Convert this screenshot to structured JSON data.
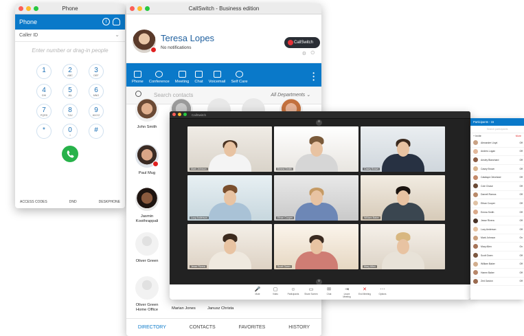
{
  "phone": {
    "title": "Phone",
    "header_label": "Phone",
    "caller_id_label": "Caller ID",
    "number_placeholder": "Enter number or drag-in people",
    "keys": [
      {
        "digit": "1",
        "letters": ""
      },
      {
        "digit": "2",
        "letters": "ABC"
      },
      {
        "digit": "3",
        "letters": "DEF"
      },
      {
        "digit": "4",
        "letters": "GHI"
      },
      {
        "digit": "5",
        "letters": "JKL"
      },
      {
        "digit": "6",
        "letters": "MNO"
      },
      {
        "digit": "7",
        "letters": "PQRS"
      },
      {
        "digit": "8",
        "letters": "TUV"
      },
      {
        "digit": "9",
        "letters": "WXYZ"
      },
      {
        "digit": "*",
        "letters": ""
      },
      {
        "digit": "0",
        "letters": "+"
      },
      {
        "digit": "#",
        "letters": ""
      }
    ],
    "footer": [
      "ACCESS CODES",
      "DND",
      "DESKPHONE"
    ]
  },
  "callswitch": {
    "title": "CallSwitch - Business edition",
    "user_name": "Teresa Lopes",
    "user_status": "No notifications",
    "logo_text": "CallSwitch",
    "nav": [
      "Phone",
      "Conference",
      "Meeting",
      "Chat",
      "Voicemail",
      "Self Care"
    ],
    "search_placeholder": "Search contacts",
    "department": "All Departments",
    "contacts": [
      "John Smith",
      "Paul Mug",
      "Jasmin Koothrappali",
      "Oliver Green",
      "Oliver Green Home Office",
      "Marian Jones",
      "Janusz Christa"
    ],
    "tabs": [
      "DIRECTORY",
      "CONTACTS",
      "FAVORITES",
      "HISTORY"
    ]
  },
  "meeting": {
    "title": "CallSwitch",
    "tiles": [
      "Mark Johnson",
      "Emma Smith",
      "Casey Brown",
      "Lucy Anderson",
      "Ethan Cooper",
      "William Baker",
      "Jesse Rivera",
      "Scott Owen",
      "Mary Allen"
    ],
    "toolbar": [
      "Mute",
      "Video",
      "Participants",
      "Share Screen",
      "Chat",
      "Leave Meeting",
      "End Meeting",
      "Options"
    ],
    "participants_count": "15",
    "colors": {
      "accent": "#0a79c9",
      "end_red": "#e02020"
    }
  },
  "participants": {
    "header": "Participants - 15",
    "search_placeholder": "Search participants",
    "invite": "+ Invite",
    "more": "More",
    "list": [
      {
        "name": "Alexander Lloyd",
        "status": "Off"
      },
      {
        "name": "Anders Logan",
        "status": "Off"
      },
      {
        "name": "Ansley Blanchard",
        "status": "Off"
      },
      {
        "name": "Casey Brown",
        "status": "Off"
      },
      {
        "name": "Catalaya Cleveland",
        "status": "Off"
      },
      {
        "name": "Cole Chase",
        "status": "Off"
      },
      {
        "name": "Darnell Ramos",
        "status": "Off"
      },
      {
        "name": "Ethan Cooper",
        "status": "Off"
      },
      {
        "name": "Emma Smith",
        "status": "Off"
      },
      {
        "name": "Jesse Rivera",
        "status": "Off"
      },
      {
        "name": "Lucy Anderson",
        "status": "Off"
      },
      {
        "name": "Mark Johnson",
        "status": "On"
      },
      {
        "name": "Mary Allen",
        "status": "On"
      },
      {
        "name": "Scott Owen",
        "status": "Off"
      },
      {
        "name": "William Baker",
        "status": "Off"
      },
      {
        "name": "Hamm Baker",
        "status": "Off"
      },
      {
        "name": "Zed Gaston",
        "status": "Off"
      }
    ]
  }
}
